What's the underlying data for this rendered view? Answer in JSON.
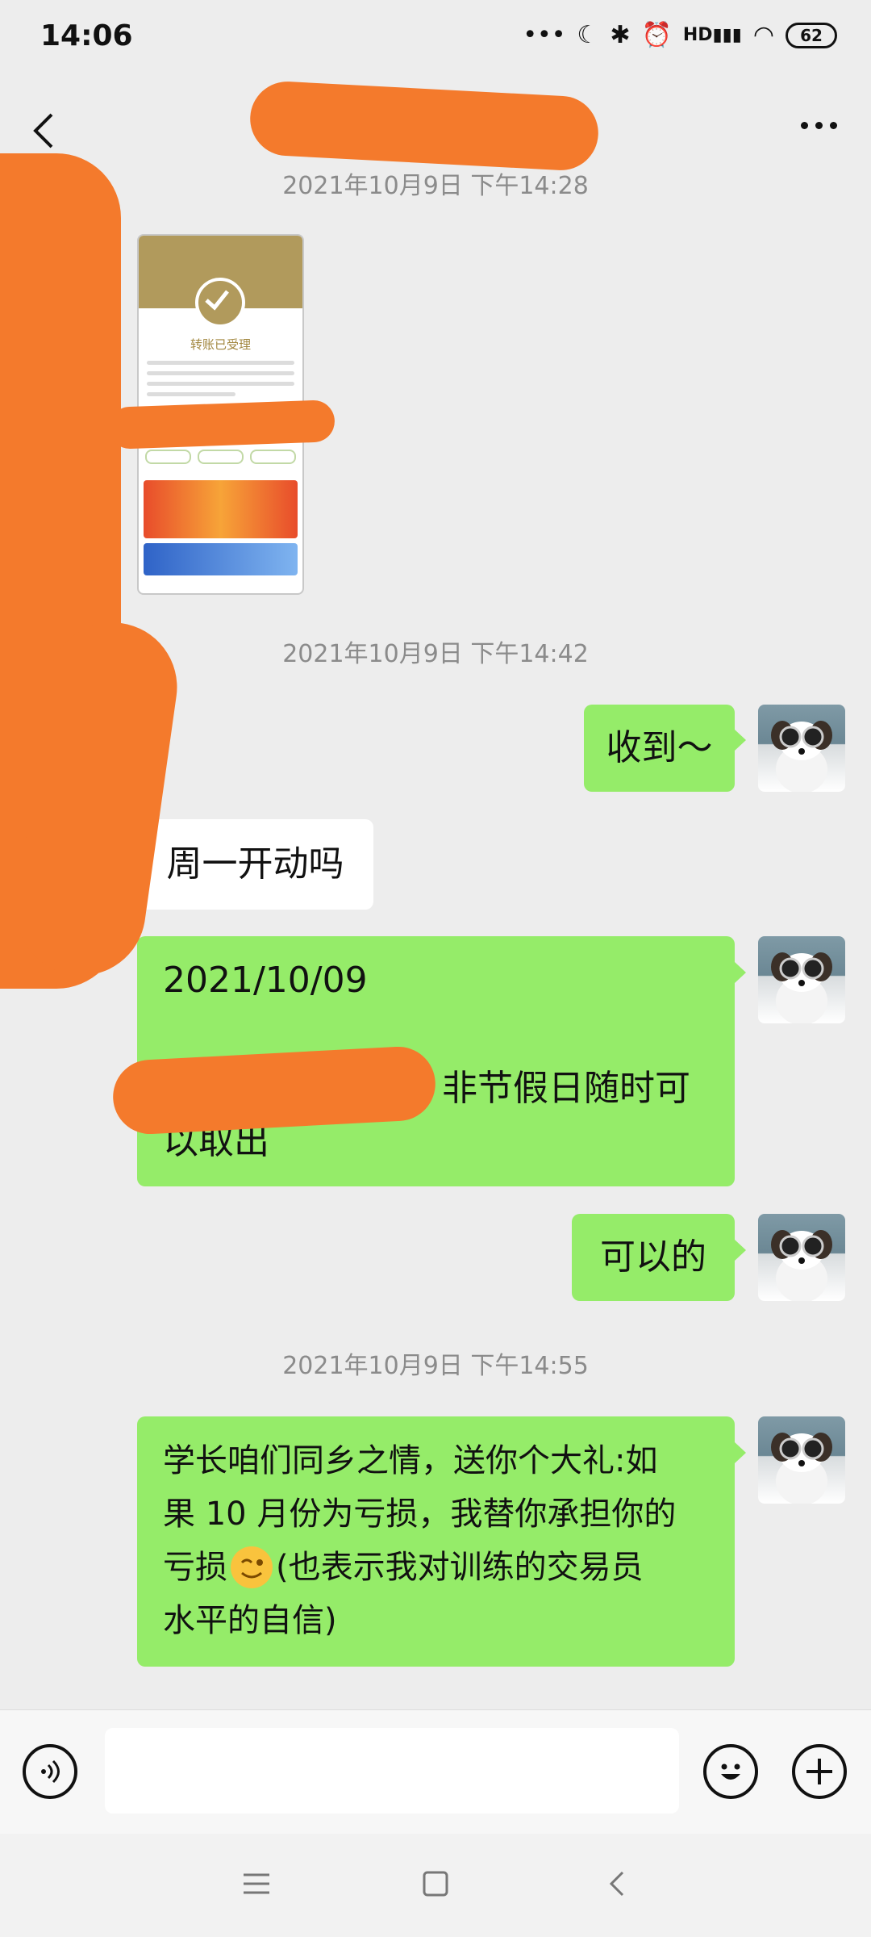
{
  "status_bar": {
    "time": "14:06",
    "icons": [
      "dots-icon",
      "moon-icon",
      "bluetooth-icon",
      "alarm-icon",
      "hd-signal-icon",
      "wifi-icon"
    ],
    "battery": "62"
  },
  "header": {
    "title": "",
    "back_icon": "chevron-left-icon",
    "more_icon": "more-dots-icon"
  },
  "messages": {
    "ts_0": "2021年10月9日 下午14:28",
    "image_message": {
      "title": "转账已受理"
    },
    "ts_1": "2021年10月9日 下午14:42",
    "msg_1": "收到～",
    "msg_2": "周一开动吗",
    "msg_3_line1": "2021/10/09",
    "msg_3_line2": "非节假日随时可",
    "msg_3_line3": "以取出",
    "msg_4": "可以的",
    "ts_2": "2021年10月9日 下午14:55",
    "msg_5_line1": "学长咱们同乡之情，送你个大礼:如",
    "msg_5_line2": "果 10 月份为亏损，我替你承担你的",
    "msg_5_line3_a": "亏损",
    "msg_5_line3_b": "(也表示我对训练的交易员",
    "msg_5_line4": "水平的自信)"
  },
  "input_bar": {
    "voice_icon": "voice-icon",
    "input_value": "",
    "emoji_icon": "emoji-icon",
    "plus_icon": "plus-icon"
  },
  "nav_bar": {
    "icons": [
      "menu-icon",
      "home-icon",
      "back-icon"
    ]
  },
  "colors": {
    "background": "#ededed",
    "bubble_green": "#95ec69",
    "bubble_white": "#ffffff",
    "redaction": "#f47a2c",
    "timestamp": "#8b8b8b"
  }
}
